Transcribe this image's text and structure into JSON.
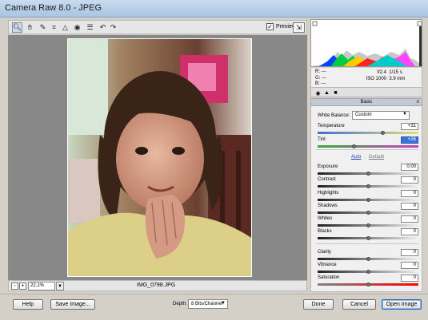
{
  "window": {
    "title": "Camera Raw 8.0  -  JPEG"
  },
  "toolbar": {
    "tools": [
      {
        "name": "zoom-tool-icon",
        "glyph": "🔍︎"
      },
      {
        "name": "hand-tool-icon",
        "glyph": "✋︎"
      },
      {
        "name": "white-balance-tool-icon",
        "glyph": "✎"
      },
      {
        "name": "crop-tool-icon",
        "glyph": "⌗"
      },
      {
        "name": "straighten-tool-icon",
        "glyph": "△"
      },
      {
        "name": "red-eye-tool-icon",
        "glyph": "◉"
      },
      {
        "name": "preferences-icon",
        "glyph": "☰"
      },
      {
        "name": "rotate-left-icon",
        "glyph": "↶"
      },
      {
        "name": "rotate-right-icon",
        "glyph": "↷"
      }
    ],
    "preview_label": "Preview",
    "preview_checked": "✓",
    "fullscreen_glyph": "⇲"
  },
  "status": {
    "zoom_out": "-",
    "zoom_in": "+",
    "zoom_value": "22.1%",
    "zoom_dropdown": "▼",
    "filename": "IMG_0798.JPG"
  },
  "readout": {
    "r": "R:  ---",
    "g": "G:  ---",
    "b": "B:  ---",
    "aperture": "f/2.4",
    "shutter": "1/15 s",
    "iso": "ISO 1000",
    "focal": "3.9 mm"
  },
  "panel_tabs": [
    "◉",
    "▲",
    "■"
  ],
  "panel": {
    "title": "Basic",
    "menu_glyph": "≡",
    "white_balance_label": "White Balance:",
    "white_balance_value": "Custom",
    "auto_label": "Auto",
    "default_label": "Default",
    "sliders": [
      {
        "label": "Temperature",
        "value": "+31",
        "level": 0.65
      },
      {
        "label": "Tint",
        "value": "+26",
        "level": 0.36,
        "selected": true
      },
      {
        "label": "Exposure",
        "value": "0.00",
        "level": 0.5
      },
      {
        "label": "Contrast",
        "value": "0",
        "level": 0.5
      },
      {
        "label": "Highlights",
        "value": "0",
        "level": 0.5
      },
      {
        "label": "Shadows",
        "value": "0",
        "level": 0.5
      },
      {
        "label": "Whites",
        "value": "0",
        "level": 0.5
      },
      {
        "label": "Blacks",
        "value": "0",
        "level": 0.5
      },
      {
        "label": "Clarity",
        "value": "0",
        "level": 0.5
      },
      {
        "label": "Vibrance",
        "value": "0",
        "level": 0.5
      },
      {
        "label": "Saturation",
        "value": "0",
        "level": 0.5
      }
    ]
  },
  "bottom": {
    "help": "Help",
    "save": "Save Image...",
    "depth_label": "Depth:",
    "depth_value": "8 Bits/Channel",
    "done": "Done",
    "cancel": "Cancel",
    "open": "Open Image"
  },
  "colors": {
    "accent": "#3875d7",
    "temperature_track": [
      "#3c6fd8",
      "#e8e070"
    ],
    "tint_track": [
      "#3caa3c",
      "#c83cc8"
    ],
    "grey_track": [
      "#202020",
      "#f0f0f0"
    ],
    "saturation_track": [
      "#808080",
      "#ff0000"
    ]
  }
}
